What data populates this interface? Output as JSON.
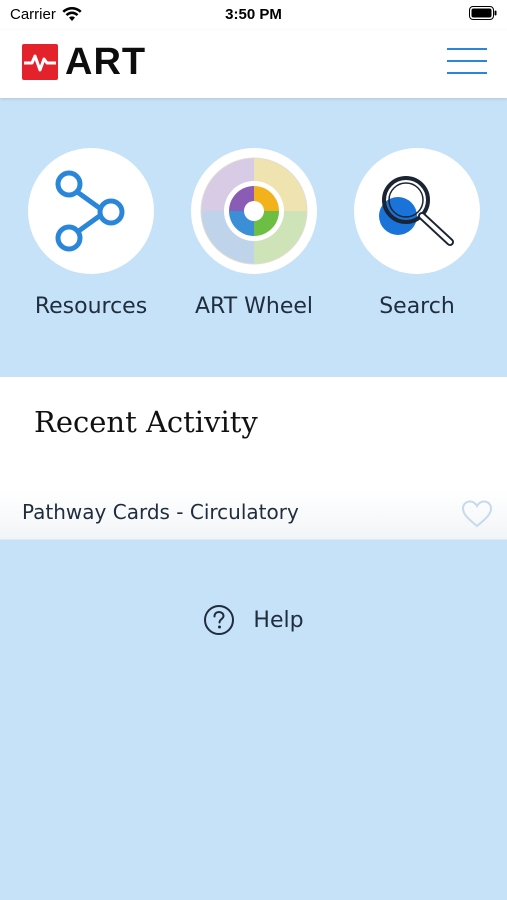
{
  "status_bar": {
    "carrier": "Carrier",
    "time": "3:50 PM"
  },
  "header": {
    "logo_text": "ART",
    "brand_color": "#e3222c",
    "menu_icon": "hamburger-icon"
  },
  "tiles": [
    {
      "label": "Resources",
      "icon": "share-nodes-icon"
    },
    {
      "label": "ART Wheel",
      "icon": "art-wheel-icon"
    },
    {
      "label": "Search",
      "icon": "magnifier-icon"
    }
  ],
  "recent": {
    "title": "Recent Activity",
    "items": [
      {
        "label": "Pathway Cards - Circulatory",
        "favorite": false
      }
    ]
  },
  "help": {
    "label": "Help",
    "icon": "question-circle-icon"
  },
  "colors": {
    "background": "#c6e2f8",
    "accent": "#2a86d9"
  }
}
